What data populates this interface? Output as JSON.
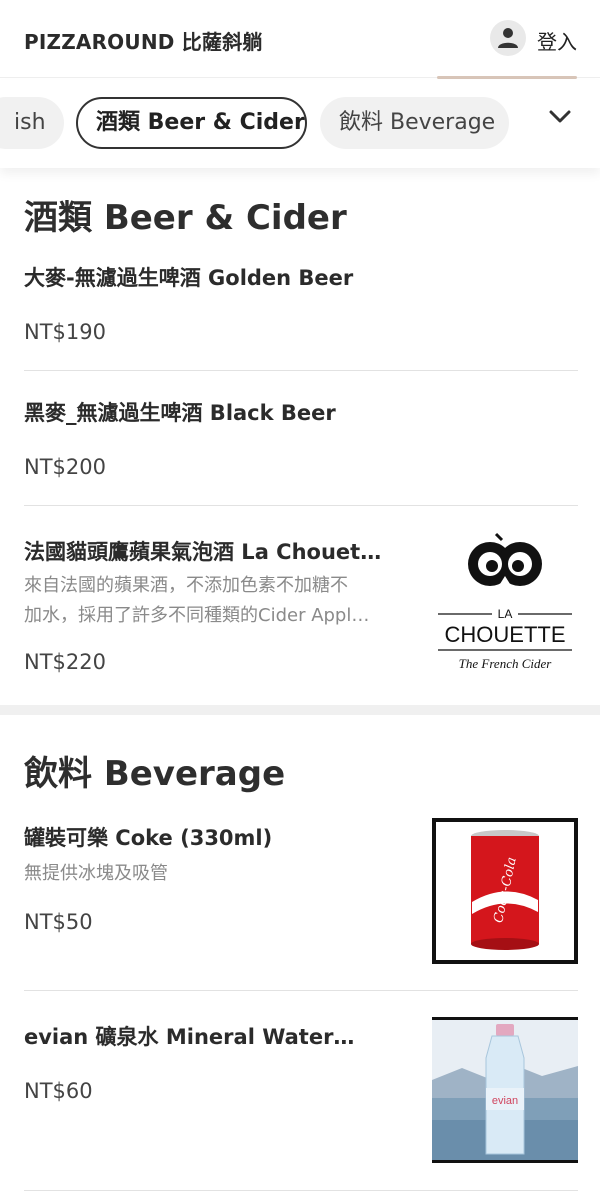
{
  "header": {
    "brand": "PIZZAROUND 比薩斜躺",
    "login": "登入",
    "icons": {
      "user": "user-icon"
    }
  },
  "tabs": [
    {
      "label": "ish"
    },
    {
      "label": "酒類 Beer & Cider",
      "active": true
    },
    {
      "label": "飲料 Beverage"
    }
  ],
  "sections": {
    "beer": {
      "title": "酒類 Beer & Cider",
      "items": [
        {
          "name": "大麥-無濾過生啤酒 Golden Beer",
          "price": "NT$190"
        },
        {
          "name": "黑麥_無濾過生啤酒 Black Beer",
          "price": "NT$200"
        },
        {
          "name": "法國貓頭鷹蘋果氣泡酒 La Chouet…",
          "desc1": "來自法國的蘋果酒，不添加色素不加糖不",
          "desc2": "加水，採用了許多不同種類的Cider Appl…",
          "price": "NT$220",
          "logo": {
            "la": "LA",
            "brand": "CHOUETTE",
            "tagline": "The French Cider"
          }
        }
      ]
    },
    "beverage": {
      "title": "飲料 Beverage",
      "items": [
        {
          "name": "罐裝可樂 Coke (330ml)",
          "desc": "無提供冰塊及吸管",
          "price": "NT$50",
          "can_text": "Coca-Cola"
        },
        {
          "name": "evian 礦泉水 Mineral Water…",
          "price": "NT$60",
          "bottle_text": "evian"
        }
      ]
    }
  },
  "colors": {
    "coke_red": "#d4161c",
    "active_border": "#333333"
  }
}
